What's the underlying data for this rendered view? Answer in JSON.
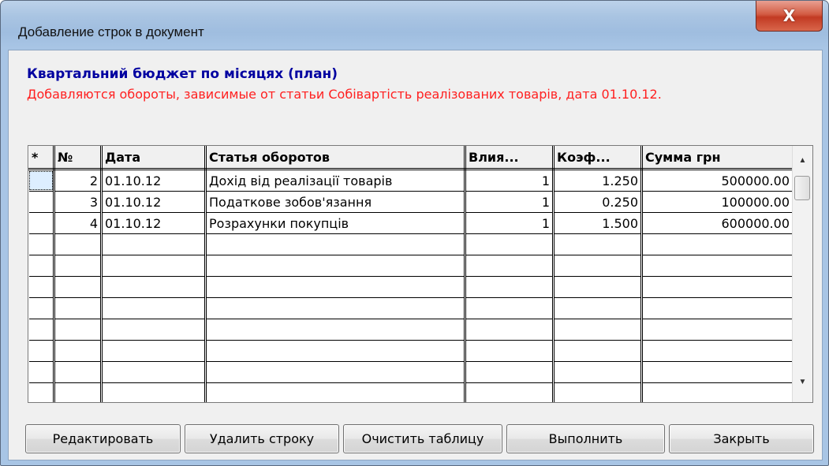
{
  "window": {
    "title": "Добавление строк в документ",
    "close_symbol": "X"
  },
  "heading": "Квартальний бюджет по місяцях (план)",
  "subheading": "Добавляются обороты, зависимые от статьи Собівартість реалізованих товарів, дата 01.10.12.",
  "table": {
    "columns": [
      "*",
      "№",
      "Дата",
      "Статья оборотов",
      "Влия...",
      "Коэф...",
      "Сумма грн"
    ],
    "rows": [
      {
        "num": "2",
        "date": "01.10.12",
        "article": "Дохід від реалізації товарів",
        "influence": "1",
        "coef": "1.250",
        "sum": "500000.00"
      },
      {
        "num": "3",
        "date": "01.10.12",
        "article": "Податкове зобов'язання",
        "influence": "1",
        "coef": "0.250",
        "sum": "100000.00"
      },
      {
        "num": "4",
        "date": "01.10.12",
        "article": "Розрахунки покупців",
        "influence": "1",
        "coef": "1.500",
        "sum": "600000.00"
      }
    ]
  },
  "buttons": {
    "edit": "Редактировать",
    "delete_row": "Удалить строку",
    "clear_table": "Очистить таблицу",
    "execute": "Выполнить",
    "close": "Закрыть"
  },
  "colors": {
    "heading": "#0000a0",
    "subheading": "#ff2020",
    "close_button": "#c23a23"
  }
}
